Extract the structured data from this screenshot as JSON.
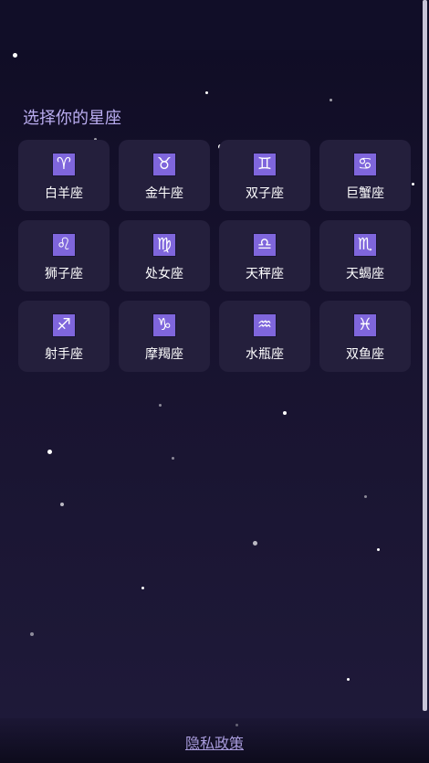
{
  "title": "选择你的星座",
  "signs": [
    {
      "label": "白羊座",
      "icon": "♈︎",
      "icon_name": "aries-icon"
    },
    {
      "label": "金牛座",
      "icon": "♉︎",
      "icon_name": "taurus-icon"
    },
    {
      "label": "双子座",
      "icon": "♊︎",
      "icon_name": "gemini-icon"
    },
    {
      "label": "巨蟹座",
      "icon": "♋︎",
      "icon_name": "cancer-icon"
    },
    {
      "label": "狮子座",
      "icon": "♌︎",
      "icon_name": "leo-icon"
    },
    {
      "label": "处女座",
      "icon": "♍︎",
      "icon_name": "virgo-icon"
    },
    {
      "label": "天秤座",
      "icon": "♎︎",
      "icon_name": "libra-icon"
    },
    {
      "label": "天蝎座",
      "icon": "♏︎",
      "icon_name": "scorpio-icon"
    },
    {
      "label": "射手座",
      "icon": "♐︎",
      "icon_name": "sagittarius-icon"
    },
    {
      "label": "摩羯座",
      "icon": "♑︎",
      "icon_name": "capricorn-icon"
    },
    {
      "label": "水瓶座",
      "icon": "♒︎",
      "icon_name": "aquarius-icon"
    },
    {
      "label": "双鱼座",
      "icon": "♓︎",
      "icon_name": "pisces-icon"
    }
  ],
  "footer": {
    "privacy_label": "隐私政策"
  },
  "colors": {
    "accent": "#7f66dc",
    "card": "#241f3c",
    "title": "#b9acef",
    "background": "#18132f"
  }
}
